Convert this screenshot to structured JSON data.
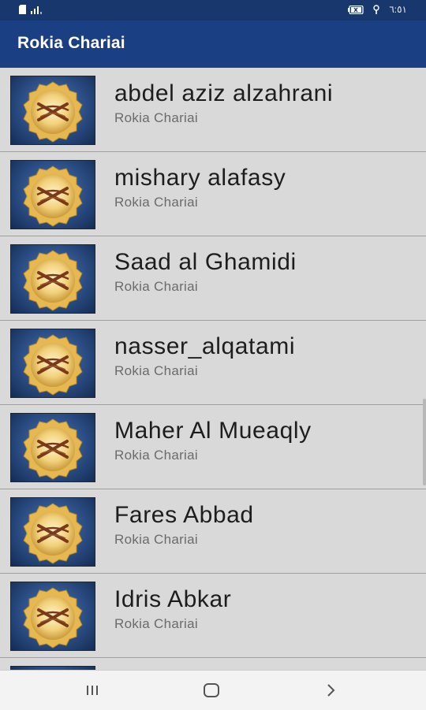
{
  "status_bar": {
    "time": "٦:٥١",
    "battery_label": "٪٥٢"
  },
  "app_bar": {
    "title": "Rokia Chariai"
  },
  "list": {
    "items": [
      {
        "title": "abdel aziz alzahrani",
        "subtitle": "Rokia Chariai",
        "icon": "quran-book-icon"
      },
      {
        "title": "mishary alafasy",
        "subtitle": "Rokia Chariai",
        "icon": "quran-book-icon"
      },
      {
        "title": "Saad al Ghamidi",
        "subtitle": "Rokia Chariai",
        "icon": "quran-book-icon"
      },
      {
        "title": "nasser_alqatami",
        "subtitle": "Rokia Chariai",
        "icon": "quran-book-icon"
      },
      {
        "title": "Maher Al Mueaqly",
        "subtitle": "Rokia Chariai",
        "icon": "quran-book-icon"
      },
      {
        "title": "Fares Abbad",
        "subtitle": "Rokia Chariai",
        "icon": "quran-book-icon"
      },
      {
        "title": "Idris Abkar",
        "subtitle": "Rokia Chariai",
        "icon": "quran-book-icon"
      }
    ]
  },
  "nav_bar": {
    "icons": [
      "recent-apps-icon",
      "home-icon",
      "back-icon"
    ]
  },
  "colors": {
    "app_bar": "#1b3f83",
    "status_bar": "#18376c",
    "list_background": "#d9d9d9"
  }
}
